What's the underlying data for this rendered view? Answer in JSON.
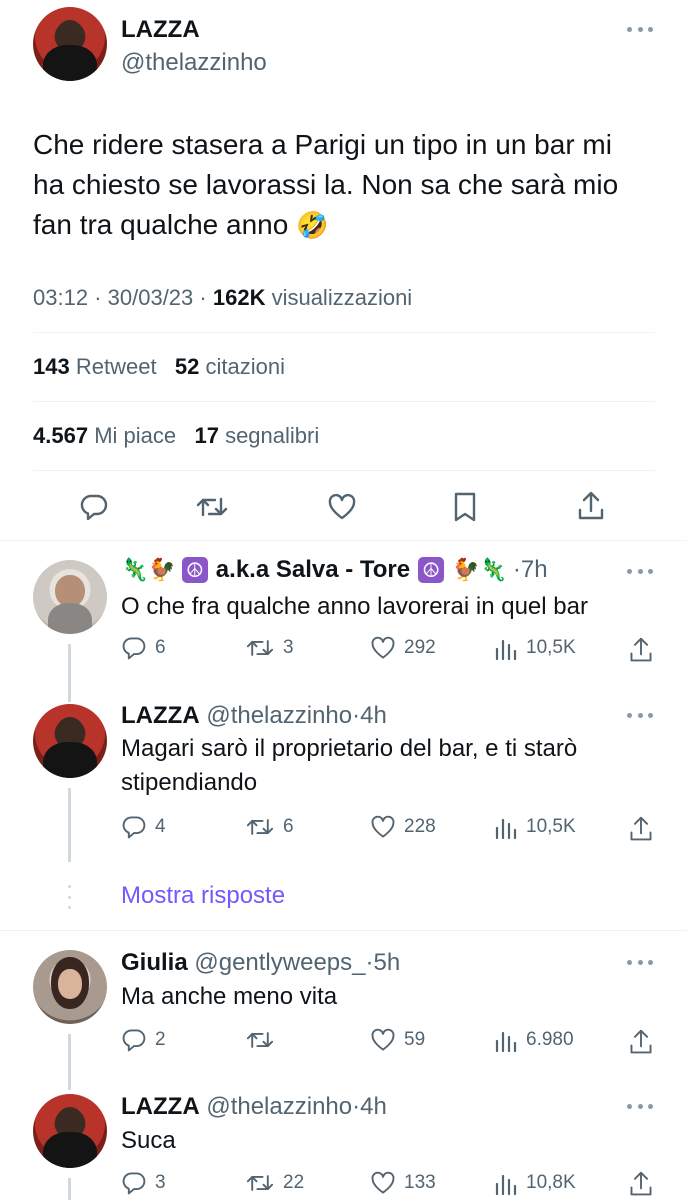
{
  "main_tweet": {
    "author_name": "LAZZA",
    "author_handle": "@thelazzinho",
    "text_lines": [
      "Che ridere stasera a Parigi un tipo in un bar mi",
      "ha chiesto se lavorassi la. Non sa che sarà mio",
      "fan tra qualche anno"
    ],
    "text_emoji": "🤣",
    "time": "03:12",
    "date": "30/03/23",
    "views_count": "162K",
    "views_label": "visualizzazioni",
    "retweets_count": "143",
    "retweets_label": "Retweet",
    "quotes_count": "52",
    "quotes_label": "citazioni",
    "likes_count": "4.567",
    "likes_label": "Mi piace",
    "bookmarks_count": "17",
    "bookmarks_label": "segnalibri",
    "icons": [
      "reply-icon",
      "retweet-icon",
      "like-icon",
      "bookmark-icon",
      "share-icon"
    ]
  },
  "replies": [
    {
      "emoji_left": "🦎🐓",
      "name": "a.k.a Salva - Tore",
      "emoji_right": "🐓🦎",
      "peace": "☮",
      "time": "7h",
      "text": "O che fra qualche anno lavorerai in quel bar",
      "replies": "6",
      "retweets": "3",
      "likes": "292",
      "views": "10,5K"
    },
    {
      "name": "LAZZA",
      "handle": "@thelazzinho",
      "time": "4h",
      "text_lines": [
        "Magari sarò il proprietario del bar, e ti starò",
        "stipendiando"
      ],
      "replies": "4",
      "retweets": "6",
      "likes": "228",
      "views": "10,5K"
    },
    {
      "name": "Giulia",
      "handle": "@gentlyweeps_",
      "time": "5h",
      "text": "Ma anche meno vita",
      "replies": "2",
      "retweets": "",
      "likes": "59",
      "views": "6.980"
    },
    {
      "name": "LAZZA",
      "handle": "@thelazzinho",
      "time": "4h",
      "text": "Suca",
      "replies": "3",
      "retweets": "22",
      "likes": "133",
      "views": "10,8K"
    }
  ],
  "show_replies_label": "Mostra risposte",
  "separator": "·",
  "colors": {
    "text": "#0f1419",
    "muted": "#536471",
    "accent": "#7856ff",
    "divider": "#eff3f4"
  }
}
